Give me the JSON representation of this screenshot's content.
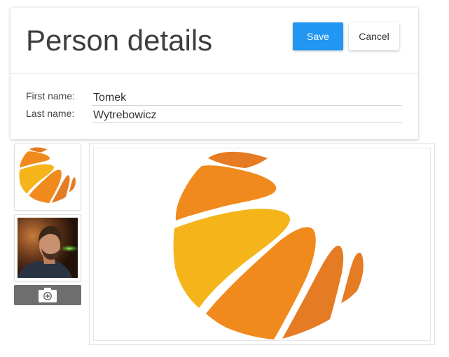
{
  "header": {
    "title": "Person details",
    "save_label": "Save",
    "cancel_label": "Cancel"
  },
  "form": {
    "first_name_label": "First name:",
    "first_name_value": "Tomek",
    "last_name_label": "Last name:",
    "last_name_value": "Wytrebowicz"
  },
  "photos": {
    "thumbnails": [
      {
        "kind": "logo",
        "selected": true
      },
      {
        "kind": "person-photo",
        "selected": false
      }
    ],
    "add_photo_icon": "camera-plus-icon"
  },
  "colors": {
    "primary": "#2196f3",
    "logo_orange": "#f08a1c",
    "logo_dark_orange": "#e57b22",
    "logo_yellow": "#f5b41a",
    "add_photo_bar": "#6e6e6e"
  }
}
